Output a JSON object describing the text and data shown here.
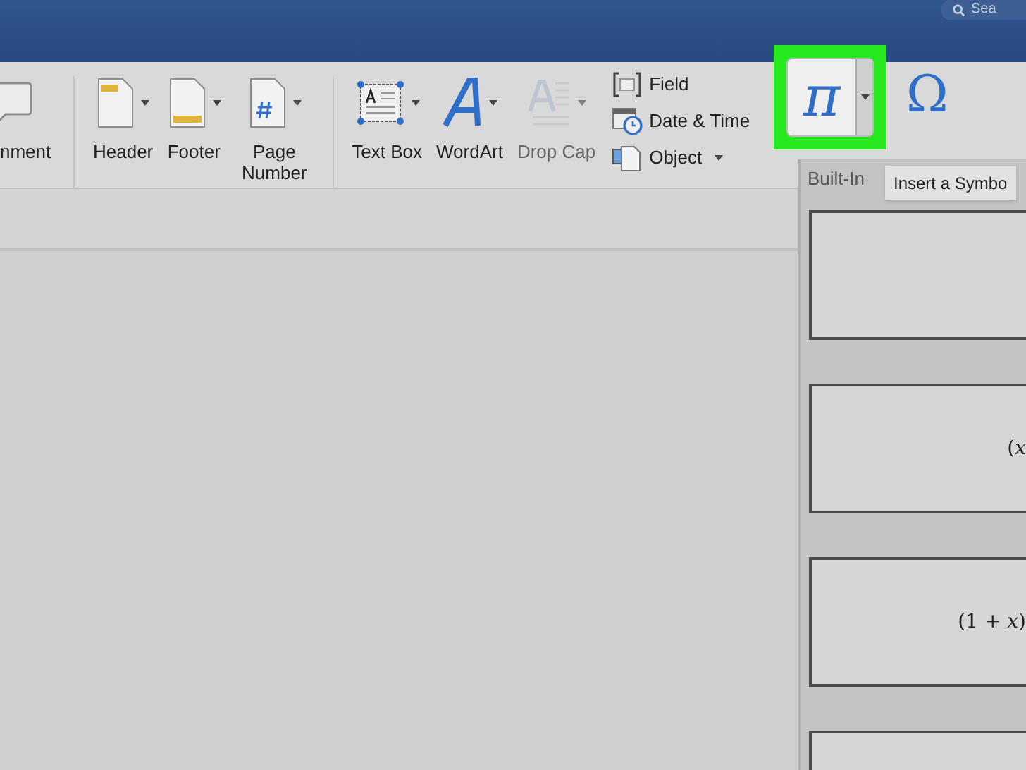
{
  "search": {
    "placeholder": "Sea"
  },
  "ribbon": {
    "large_buttons": [
      {
        "kind": "comment",
        "label": "nment",
        "disabled": false
      },
      {
        "kind": "header",
        "label": "Header",
        "disabled": false,
        "dropdown": true
      },
      {
        "kind": "footer",
        "label": "Footer",
        "disabled": false,
        "dropdown": true
      },
      {
        "kind": "pagenumber",
        "label": "Page Number",
        "disabled": false,
        "dropdown": true
      },
      {
        "kind": "textbox",
        "label": "Text Box",
        "disabled": false,
        "dropdown": true
      },
      {
        "kind": "wordart",
        "label": "WordArt",
        "disabled": false,
        "dropdown": true
      },
      {
        "kind": "dropcap",
        "label": "Drop Cap",
        "disabled": true,
        "dropdown": true
      }
    ],
    "small_buttons": [
      {
        "kind": "field",
        "label": "Field",
        "dropdown": false
      },
      {
        "kind": "datetime",
        "label": "Date & Time",
        "dropdown": false
      },
      {
        "kind": "object",
        "label": "Object",
        "dropdown": true
      }
    ],
    "equation_button": {
      "symbol": "π",
      "highlighted": true
    },
    "symbol_button": {
      "symbol": "Ω"
    }
  },
  "tooltip": "Insert a Symbo",
  "equation_panel": {
    "heading": "Built-In",
    "cards": [
      {
        "kind": "blank"
      },
      {
        "kind": "equation",
        "text": "(*x*"
      },
      {
        "kind": "equation",
        "text": "(1 + *x*)"
      },
      {
        "kind": "blank"
      }
    ]
  }
}
